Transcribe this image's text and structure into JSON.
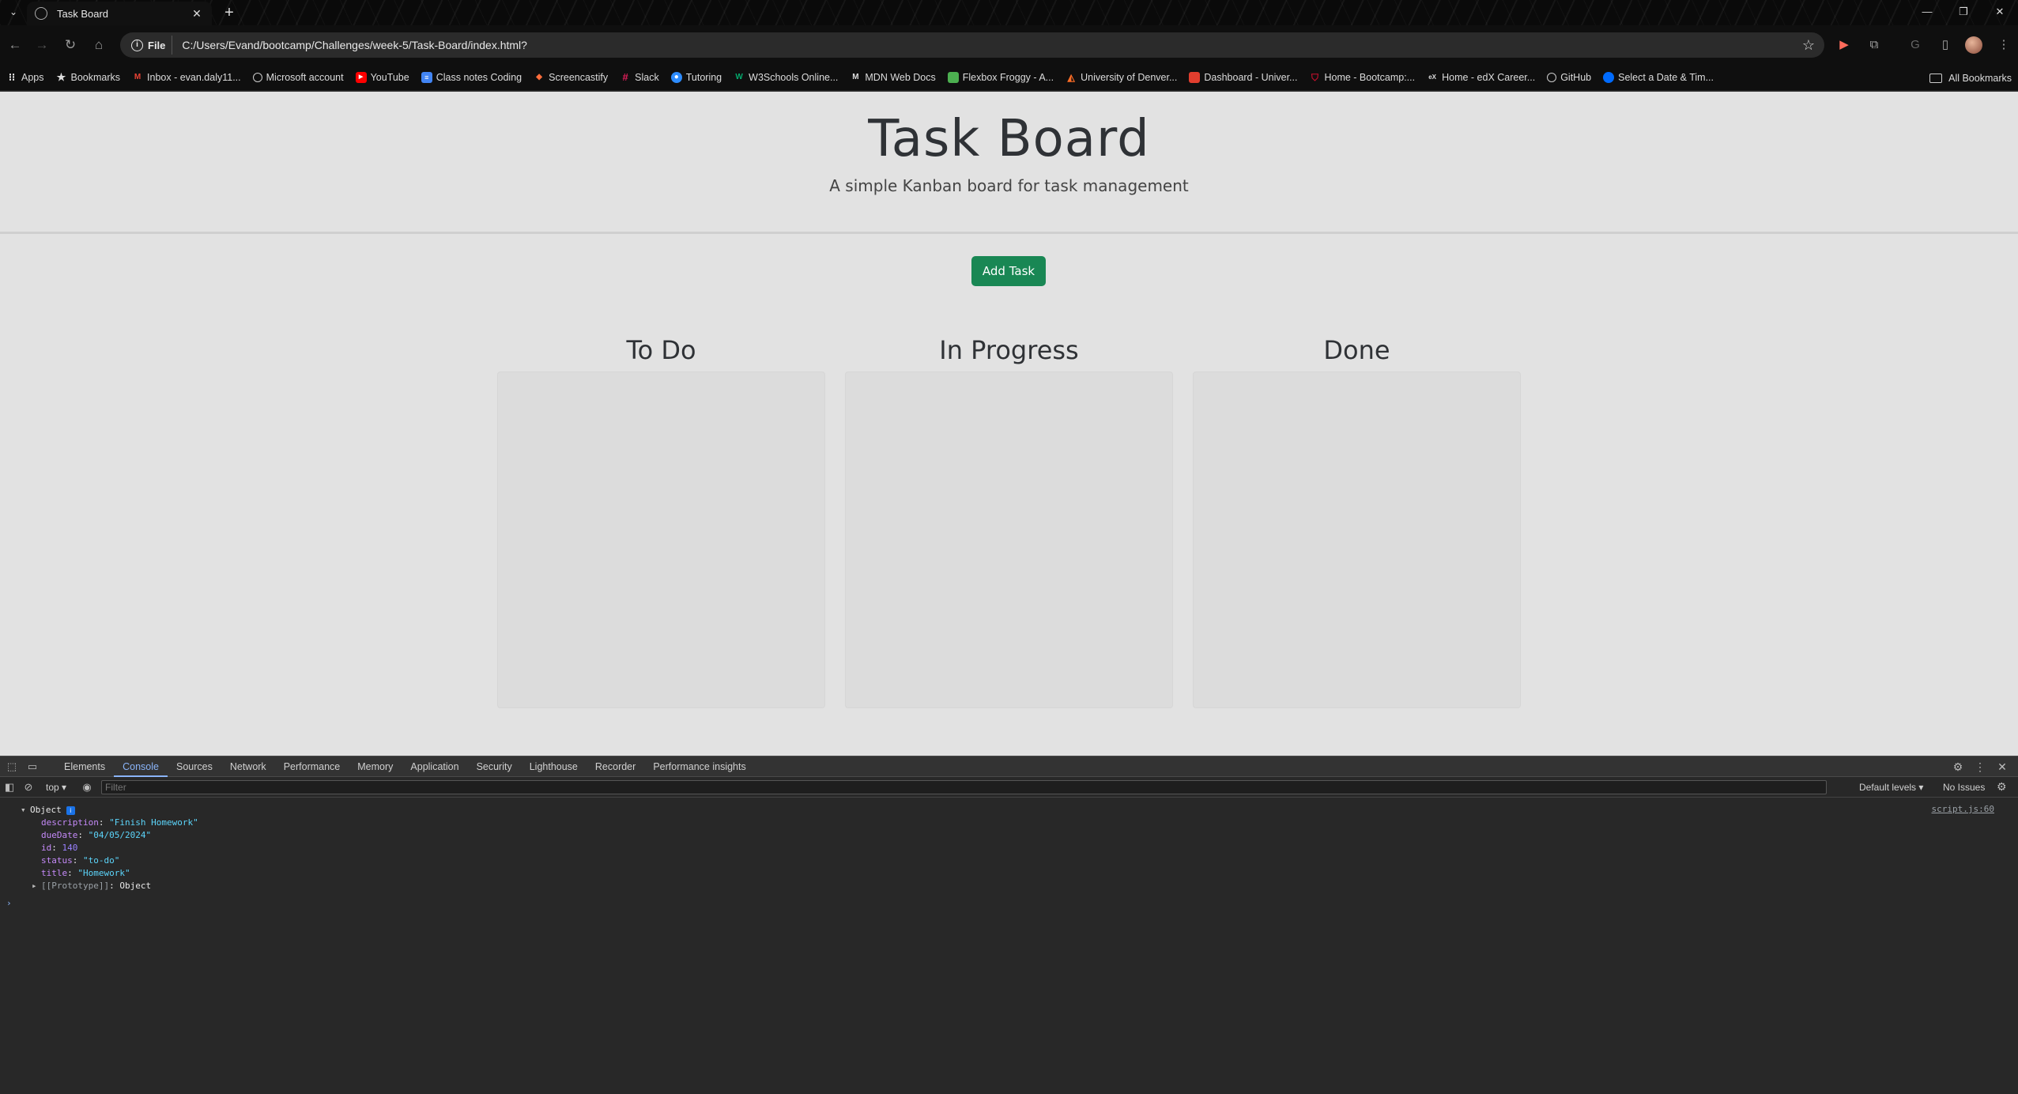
{
  "browser": {
    "tab": {
      "title": "Task Board",
      "close": "✕"
    },
    "new_tab": "+",
    "window_controls": [
      "—",
      "❐",
      "✕"
    ],
    "address": {
      "chip": "File",
      "url": "C:/Users/Evand/bootcamp/Challenges/week-5/Task-Board/index.html?"
    },
    "bookmarks": [
      {
        "label": "Apps",
        "icon": "apps-grid-icon",
        "color": "#ffffff"
      },
      {
        "label": "Bookmarks",
        "icon": "star-icon",
        "color": "#dddddd"
      },
      {
        "label": "Inbox - evan.daly11...",
        "icon": "gmail-icon",
        "color": "#ea4335"
      },
      {
        "label": "Microsoft account",
        "icon": "microsoft-icon",
        "color": "#dddddd"
      },
      {
        "label": "YouTube",
        "icon": "youtube-icon",
        "color": "#ff0000"
      },
      {
        "label": "Class notes Coding",
        "icon": "docs-icon",
        "color": "#4285f4"
      },
      {
        "label": "Screencastify",
        "icon": "screencastify-icon",
        "color": "#ff6d3b"
      },
      {
        "label": "Slack",
        "icon": "slack-icon",
        "color": "#e01e5a"
      },
      {
        "label": "Tutoring",
        "icon": "tutoring-icon",
        "color": "#2d8cff"
      },
      {
        "label": "W3Schools Online...",
        "icon": "w3schools-icon",
        "color": "#04aa6d"
      },
      {
        "label": "MDN Web Docs",
        "icon": "mdn-icon",
        "color": "#dddddd"
      },
      {
        "label": "Flexbox Froggy - A...",
        "icon": "froggy-icon",
        "color": "#4caf50"
      },
      {
        "label": "University of Denver...",
        "icon": "gitlab-icon",
        "color": "#fc6d26"
      },
      {
        "label": "Dashboard - Univer...",
        "icon": "canvas-icon",
        "color": "#e13e2e"
      },
      {
        "label": "Home - Bootcamp:...",
        "icon": "shield-icon",
        "color": "#c8102e"
      },
      {
        "label": "Home - edX Career...",
        "icon": "edx-icon",
        "color": "#dddddd"
      },
      {
        "label": "GitHub",
        "icon": "github-icon",
        "color": "#dddddd"
      },
      {
        "label": "Select a Date & Tim...",
        "icon": "calendly-icon",
        "color": "#006bff"
      }
    ],
    "all_bookmarks": "All Bookmarks"
  },
  "page": {
    "title": "Task Board",
    "subtitle": "A simple Kanban board for task management",
    "add_button": "Add Task",
    "lanes": [
      {
        "title": "To Do"
      },
      {
        "title": "In Progress"
      },
      {
        "title": "Done"
      }
    ],
    "colors": {
      "background": "#e2e2e2",
      "button": "#198754"
    }
  },
  "devtools": {
    "tabs": [
      "Elements",
      "Console",
      "Sources",
      "Network",
      "Performance",
      "Memory",
      "Application",
      "Security",
      "Lighthouse",
      "Recorder",
      "Performance insights"
    ],
    "active_tab": "Console",
    "context": "top ▾",
    "filter_placeholder": "Filter",
    "levels": "Default levels ▾",
    "issues": "No Issues",
    "log": {
      "source": "script.js:60",
      "header": "Object",
      "props": [
        {
          "key": "description",
          "value": "\"Finish Homework\""
        },
        {
          "key": "dueDate",
          "value": "\"04/05/2024\""
        },
        {
          "key": "id",
          "value": "140"
        },
        {
          "key": "status",
          "value": "\"to-do\""
        },
        {
          "key": "title",
          "value": "\"Homework\""
        }
      ],
      "prototype_key": "[[Prototype]]",
      "prototype_value": "Object"
    }
  }
}
